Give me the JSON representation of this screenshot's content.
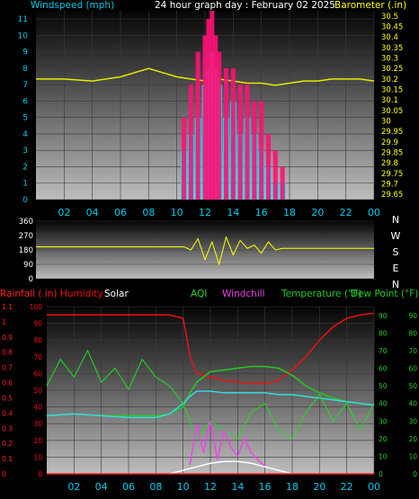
{
  "colors": {
    "background": "#000000",
    "wind_axis": "#00c8e8",
    "wind_label": "#00c8e8",
    "baro_axis": "#ffff00",
    "baro_line": "#e8e800",
    "wind_avg": "#00e8f0",
    "gust": "#ff1177",
    "wind_direction": "#ffff00",
    "rain": "#ff2020",
    "humidity": "#ee1111",
    "solar": "#ffffff",
    "aqi": "#22dd22",
    "windchill": "#ee44ee",
    "temperature": "#22cc22",
    "dew_point": "#33dddd",
    "x_axis_labels": "#00ccee"
  },
  "chart_data": [
    {
      "type": "line",
      "title": "24 hour graph day : February 02 2025",
      "left_axis_label": "Windspeed (mph)",
      "right_axis_label": "Barometer (.in)",
      "x_ticks": [
        "02",
        "04",
        "06",
        "08",
        "10",
        "12",
        "14",
        "16",
        "18",
        "20",
        "22",
        "00"
      ],
      "ylim_left": [
        0,
        11.5
      ],
      "yticks_left": [
        "0",
        "1",
        "2",
        "3",
        "4",
        "5",
        "6",
        "7",
        "8",
        "9",
        "10",
        "11"
      ],
      "ylim_right": [
        29.625,
        30.525
      ],
      "yticks_right": [
        "29.65",
        "29.7",
        "29.75",
        "29.8",
        "29.85",
        "29.9",
        "29.95",
        "30",
        "30.05",
        "30.1",
        "30.15",
        "30.2",
        "30.25",
        "30.3",
        "30.35",
        "30.4",
        "30.45",
        "30.5"
      ],
      "series": [
        {
          "key": "barometer",
          "axis": "right",
          "x": [
            0,
            2,
            4,
            6,
            7,
            8,
            9,
            10,
            11,
            12,
            13,
            14,
            15,
            16,
            17,
            18,
            19,
            20,
            21,
            22,
            23,
            24
          ],
          "values": [
            30.2,
            30.2,
            30.19,
            30.21,
            30.23,
            30.25,
            30.23,
            30.21,
            30.2,
            30.19,
            30.2,
            30.19,
            30.18,
            30.18,
            30.17,
            30.18,
            30.19,
            30.19,
            30.2,
            30.2,
            30.2,
            30.19
          ]
        },
        {
          "key": "wind_avg",
          "axis": "left",
          "style": "bars",
          "x": [
            10.5,
            11,
            11.5,
            12,
            12.25,
            12.5,
            12.75,
            13,
            13.5,
            14,
            14.5,
            15,
            15.5,
            16,
            16.5,
            17,
            17.5
          ],
          "values": [
            3,
            4,
            5,
            7,
            8,
            9,
            8,
            7,
            5,
            6,
            4,
            5,
            4,
            3,
            2,
            1,
            1
          ]
        },
        {
          "key": "gust",
          "axis": "left",
          "style": "bars",
          "x": [
            10.5,
            11,
            11.5,
            12,
            12.25,
            12.5,
            12.75,
            13,
            13.5,
            14,
            14.5,
            15,
            15.5,
            16,
            16.5,
            17,
            17.5
          ],
          "values": [
            5,
            7,
            9,
            10,
            11,
            11.5,
            10,
            9,
            8,
            8,
            7,
            7,
            6,
            6,
            4,
            3,
            2
          ]
        }
      ]
    },
    {
      "type": "line",
      "left_axis_ticks": [
        "360",
        "270",
        "180",
        "90",
        "0"
      ],
      "right_axis_ticks": [
        "N",
        "W",
        "S",
        "E",
        "N"
      ],
      "ylim": [
        0,
        360
      ],
      "series": [
        {
          "key": "wind_direction",
          "x": [
            0,
            10.5,
            11,
            11.5,
            12,
            12.5,
            13,
            13.5,
            14,
            14.5,
            15,
            15.5,
            16,
            16.5,
            17,
            17.5,
            24
          ],
          "values": [
            200,
            200,
            180,
            250,
            120,
            230,
            90,
            260,
            150,
            240,
            190,
            210,
            160,
            230,
            180,
            190,
            190
          ]
        }
      ]
    },
    {
      "type": "line",
      "legend": [
        "Rainfall (.in)",
        "Humidity",
        "Solar",
        "AQI",
        "Windchill",
        "Temperature (°F)",
        "Dew Point (°F)"
      ],
      "x_ticks": [
        "02",
        "04",
        "06",
        "08",
        "10",
        "12",
        "14",
        "16",
        "18",
        "20",
        "22",
        "00"
      ],
      "ylim_left": [
        0,
        100
      ],
      "yticks_left_outer": [
        "0",
        "0.1",
        "0.2",
        "0.3",
        "0.4",
        "0.5",
        "0.6",
        "0.7",
        "0.8",
        "0.9",
        "1",
        "1.1"
      ],
      "yticks_left_inner": [
        "0",
        "10",
        "20",
        "30",
        "40",
        "50",
        "60",
        "70",
        "80",
        "90",
        "100"
      ],
      "ylim_right": [
        0,
        95
      ],
      "yticks_right_inner": [
        "0",
        "10",
        "20",
        "30",
        "40",
        "50",
        "60",
        "70",
        "80",
        "90"
      ],
      "yticks_right_outer": [
        "0",
        "10",
        "20",
        "30",
        "40",
        "50",
        "60",
        "70",
        "80",
        "90"
      ],
      "series": [
        {
          "key": "humidity",
          "x": [
            0,
            2,
            4,
            6,
            8,
            9,
            10,
            10.3,
            10.5,
            11,
            12,
            13,
            14,
            15,
            16,
            17,
            18,
            19,
            20,
            21,
            22,
            23,
            24
          ],
          "values": [
            95,
            95,
            95,
            95,
            95,
            95,
            93,
            80,
            70,
            60,
            58,
            56,
            55,
            54,
            54,
            56,
            62,
            70,
            80,
            88,
            93,
            95,
            96
          ]
        },
        {
          "key": "temperature",
          "x": [
            0,
            2,
            4,
            6,
            8,
            9,
            10,
            10.5,
            11,
            12,
            13,
            14,
            15,
            16,
            17,
            18,
            19,
            20,
            21,
            22,
            23,
            24
          ],
          "values": [
            33,
            34,
            33,
            33,
            33,
            34,
            38,
            46,
            52,
            58,
            59,
            60,
            61,
            61,
            60,
            56,
            50,
            46,
            43,
            41,
            40,
            39
          ]
        },
        {
          "key": "dew_point",
          "x": [
            0,
            2,
            4,
            6,
            8,
            9,
            10,
            10.5,
            11,
            12,
            13,
            14,
            15,
            16,
            17,
            18,
            19,
            20,
            21,
            22,
            23,
            24
          ],
          "values": [
            33,
            34,
            33,
            32,
            32,
            34,
            40,
            44,
            47,
            47,
            46,
            46,
            46,
            46,
            45,
            45,
            44,
            43,
            42,
            41,
            40,
            39
          ]
        },
        {
          "key": "aqi",
          "x": [
            0,
            1,
            2,
            3,
            4,
            5,
            6,
            7,
            8,
            9,
            10,
            11,
            12,
            13,
            14,
            15,
            16,
            17,
            18,
            19,
            20,
            21,
            22,
            23,
            24
          ],
          "values": [
            50,
            65,
            55,
            70,
            52,
            60,
            48,
            65,
            55,
            50,
            40,
            20,
            30,
            25,
            20,
            35,
            40,
            25,
            20,
            35,
            45,
            30,
            40,
            25,
            40
          ]
        },
        {
          "key": "windchill",
          "x": [
            10.5,
            11,
            11.5,
            12,
            12.5,
            13,
            13.5,
            14,
            14.5,
            15,
            15.5,
            16
          ],
          "values": [
            5,
            28,
            12,
            30,
            8,
            25,
            15,
            10,
            20,
            12,
            8,
            4
          ]
        },
        {
          "key": "solar",
          "x": [
            9,
            10,
            11,
            12,
            13,
            14,
            15,
            16,
            17,
            18
          ],
          "values": [
            0,
            2,
            4,
            6,
            7,
            7,
            6,
            4,
            2,
            0
          ]
        },
        {
          "key": "rain",
          "x": [
            0,
            24
          ],
          "values": [
            0,
            0
          ]
        }
      ]
    }
  ]
}
